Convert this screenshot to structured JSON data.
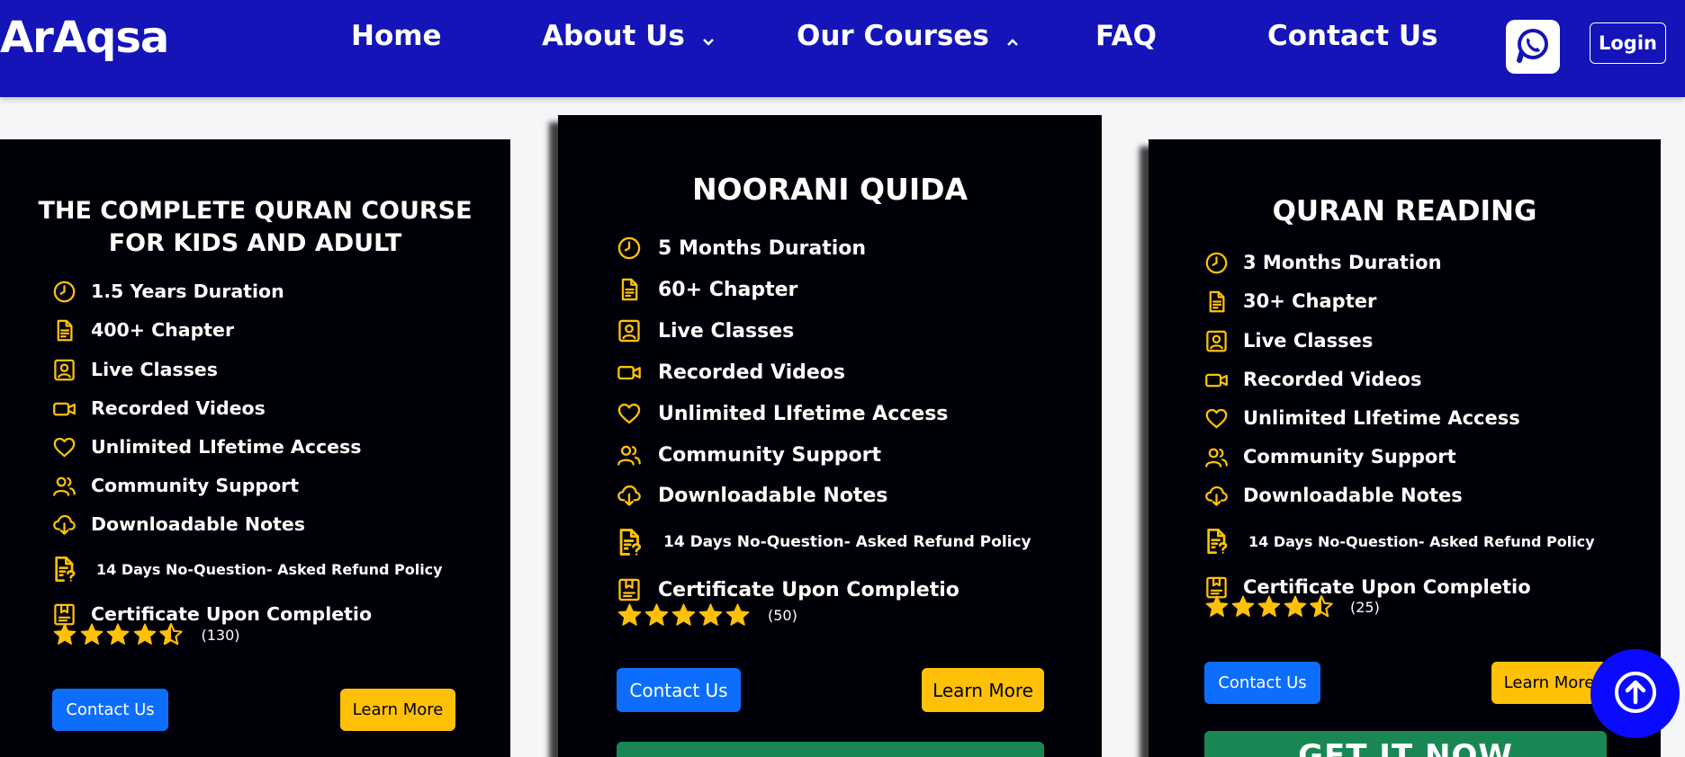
{
  "nav": {
    "brand": "ArAqsa",
    "home": "Home",
    "about": "About Us",
    "courses": "Our Courses",
    "faq": "FAQ",
    "contact": "Contact Us",
    "login": "Login"
  },
  "colors": {
    "nav_bg": "#1414b8",
    "accent": "#ffc107",
    "blue": "#0d6efd",
    "green": "#198754"
  },
  "cards": [
    {
      "title_line1": "THE COMPLETE QURAN COURSE",
      "title_line2": "FOR KIDS AND ADULT",
      "features": [
        "1.5 Years Duration",
        "400+ Chapter",
        "Live Classes",
        "Recorded Videos",
        "Unlimited LIfetime Access",
        "Community Support",
        "Downloadable Notes",
        "14 Days No-Question- Asked Refund Policy",
        "Certificate Upon Completio"
      ],
      "rating": 4.5,
      "rating_count": "(130)",
      "contact_label": "Contact Us",
      "learn_label": "Learn More"
    },
    {
      "title_line1": "NOORANI QUIDA",
      "features": [
        "5 Months Duration",
        "60+ Chapter",
        "Live Classes",
        "Recorded Videos",
        "Unlimited LIfetime Access",
        "Community Support",
        "Downloadable Notes",
        "14 Days No-Question- Asked Refund Policy",
        "Certificate Upon Completio"
      ],
      "rating": 5,
      "rating_count": "(50)",
      "contact_label": "Contact Us",
      "learn_label": "Learn More"
    },
    {
      "title_line1": "QURAN READING",
      "features": [
        "3 Months Duration",
        "30+ Chapter",
        "Live Classes",
        "Recorded Videos",
        "Unlimited LIfetime Access",
        "Community Support",
        "Downloadable Notes",
        "14 Days No-Question- Asked Refund Policy",
        "Certificate Upon Completio"
      ],
      "rating": 4.5,
      "rating_count": "(25)",
      "contact_label": "Contact Us",
      "learn_label": "Learn More",
      "get_it_label": "GET IT NOW"
    }
  ],
  "icons": [
    "clock-icon",
    "document-icon",
    "person-badge-icon",
    "video-camera-icon",
    "heart-icon",
    "people-icon",
    "cloud-download-icon",
    "document-question-icon",
    "certificate-icon",
    "star-icon",
    "whatsapp-icon",
    "arrow-up-circle-icon"
  ]
}
